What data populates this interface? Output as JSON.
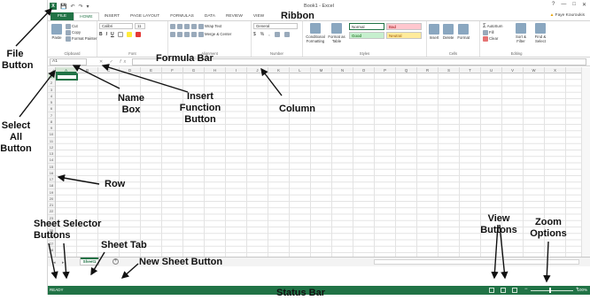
{
  "window": {
    "title": "Book1 - Excel",
    "user_name": "Faye Kouroukis",
    "min_glyph": "—",
    "restore_glyph": "□",
    "close_glyph": "✕",
    "help_glyph": "?",
    "warning_glyph": "▲"
  },
  "quick_access": {
    "save_glyph": "💾",
    "undo_glyph": "↶",
    "redo_glyph": "↷",
    "customize_glyph": "▾"
  },
  "tabs": [
    {
      "label": "FILE"
    },
    {
      "label": "HOME"
    },
    {
      "label": "INSERT"
    },
    {
      "label": "PAGE LAYOUT"
    },
    {
      "label": "FORMULAS"
    },
    {
      "label": "DATA"
    },
    {
      "label": "REVIEW"
    },
    {
      "label": "VIEW"
    }
  ],
  "ribbon": {
    "clipboard": {
      "label": "Clipboard",
      "paste": "Paste",
      "cut": "Cut",
      "copy": "Copy",
      "format_painter": "Format Painter"
    },
    "font": {
      "label": "Font",
      "font_name": "Calibri",
      "font_size": "11",
      "bold": "B",
      "italic": "I",
      "underline": "U"
    },
    "alignment": {
      "label": "Alignment",
      "wrap_text": "Wrap Text",
      "merge_center": "Merge & Center"
    },
    "number": {
      "label": "Number",
      "format": "General",
      "currency": "$",
      "percent": "%",
      "comma": ","
    },
    "styles": {
      "label": "Styles",
      "conditional_formatting": "Conditional Formatting",
      "format_as_table": "Format as Table",
      "normal": "Normal",
      "bad": "Bad",
      "good": "Good",
      "neutral": "Neutral"
    },
    "cells": {
      "label": "Cells",
      "insert": "Insert",
      "delete": "Delete",
      "format": "Format"
    },
    "editing": {
      "label": "Editing",
      "autosum": "AutoSum",
      "fill": "Fill",
      "clear": "Clear",
      "sort_filter": "Sort & Filter",
      "find_select": "Find & Select"
    }
  },
  "formula_bar": {
    "name_box": "A1",
    "cancel": "✕",
    "enter": "✓",
    "fx": "fx",
    "value": ""
  },
  "columns": [
    "A",
    "B",
    "C",
    "D",
    "E",
    "F",
    "G",
    "H",
    "I",
    "J",
    "K",
    "L",
    "M",
    "N",
    "O",
    "P",
    "Q",
    "R",
    "S",
    "T",
    "U",
    "V",
    "W",
    "X"
  ],
  "rows": [
    "1",
    "2",
    "3",
    "4",
    "5",
    "6",
    "7",
    "8",
    "9",
    "10",
    "11",
    "12",
    "13",
    "14",
    "15",
    "16",
    "17",
    "18",
    "19",
    "20",
    "21",
    "22",
    "23",
    "24",
    "25",
    "26",
    "27",
    "28"
  ],
  "selected_cell": "A1",
  "sheet": {
    "tab_label": "Sheet1",
    "new_sheet_glyph": "+"
  },
  "status": {
    "ready": "READY",
    "zoom": "100%",
    "zoom_minus": "−",
    "zoom_plus": "+"
  },
  "callouts": {
    "file_button": "File Button",
    "ribbon": "Ribbon",
    "formula_bar": "Formula Bar",
    "name_box": "Name Box",
    "insert_function": "Insert Function Button",
    "column": "Column",
    "select_all": "Select All Button",
    "row": "Row",
    "sheet_selector": "Sheet Selector Buttons",
    "sheet_tab": "Sheet Tab",
    "new_sheet": "New Sheet Button",
    "view_buttons": "View Buttons",
    "zoom_options": "Zoom Options",
    "status_bar": "Status Bar"
  },
  "colors": {
    "excel_green": "#217346",
    "bad_fill": "#ffc7ce",
    "good_fill": "#c6efce",
    "neutral_fill": "#ffeb9c"
  }
}
